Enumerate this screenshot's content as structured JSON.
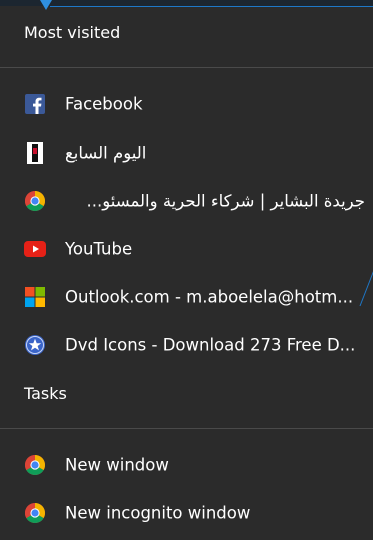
{
  "sections": {
    "most_visited": "Most visited",
    "tasks": "Tasks"
  },
  "most_visited_items": [
    {
      "label": "Facebook",
      "icon": "facebook-icon"
    },
    {
      "label": "اليوم السابع",
      "icon": "youm7-icon"
    },
    {
      "label": "جريدة البشاير | شركاء الحرية والمسئو...",
      "icon": "chrome-icon"
    },
    {
      "label": "YouTube",
      "icon": "youtube-icon"
    },
    {
      "label": "Outlook.com - m.aboelela@hotm...",
      "icon": "microsoft-icon"
    },
    {
      "label": "Dvd Icons - Download 273 Free D...",
      "icon": "star-badge-icon"
    }
  ],
  "task_items": [
    {
      "label": "New window",
      "icon": "chrome-icon"
    },
    {
      "label": "New incognito window",
      "icon": "chrome-icon"
    }
  ],
  "colors": {
    "background": "#2b2b2b",
    "divider": "#4a4a4a",
    "facebook": "#3b5998",
    "youtube_red": "#e62117",
    "accent_blue": "#1e78c8"
  }
}
